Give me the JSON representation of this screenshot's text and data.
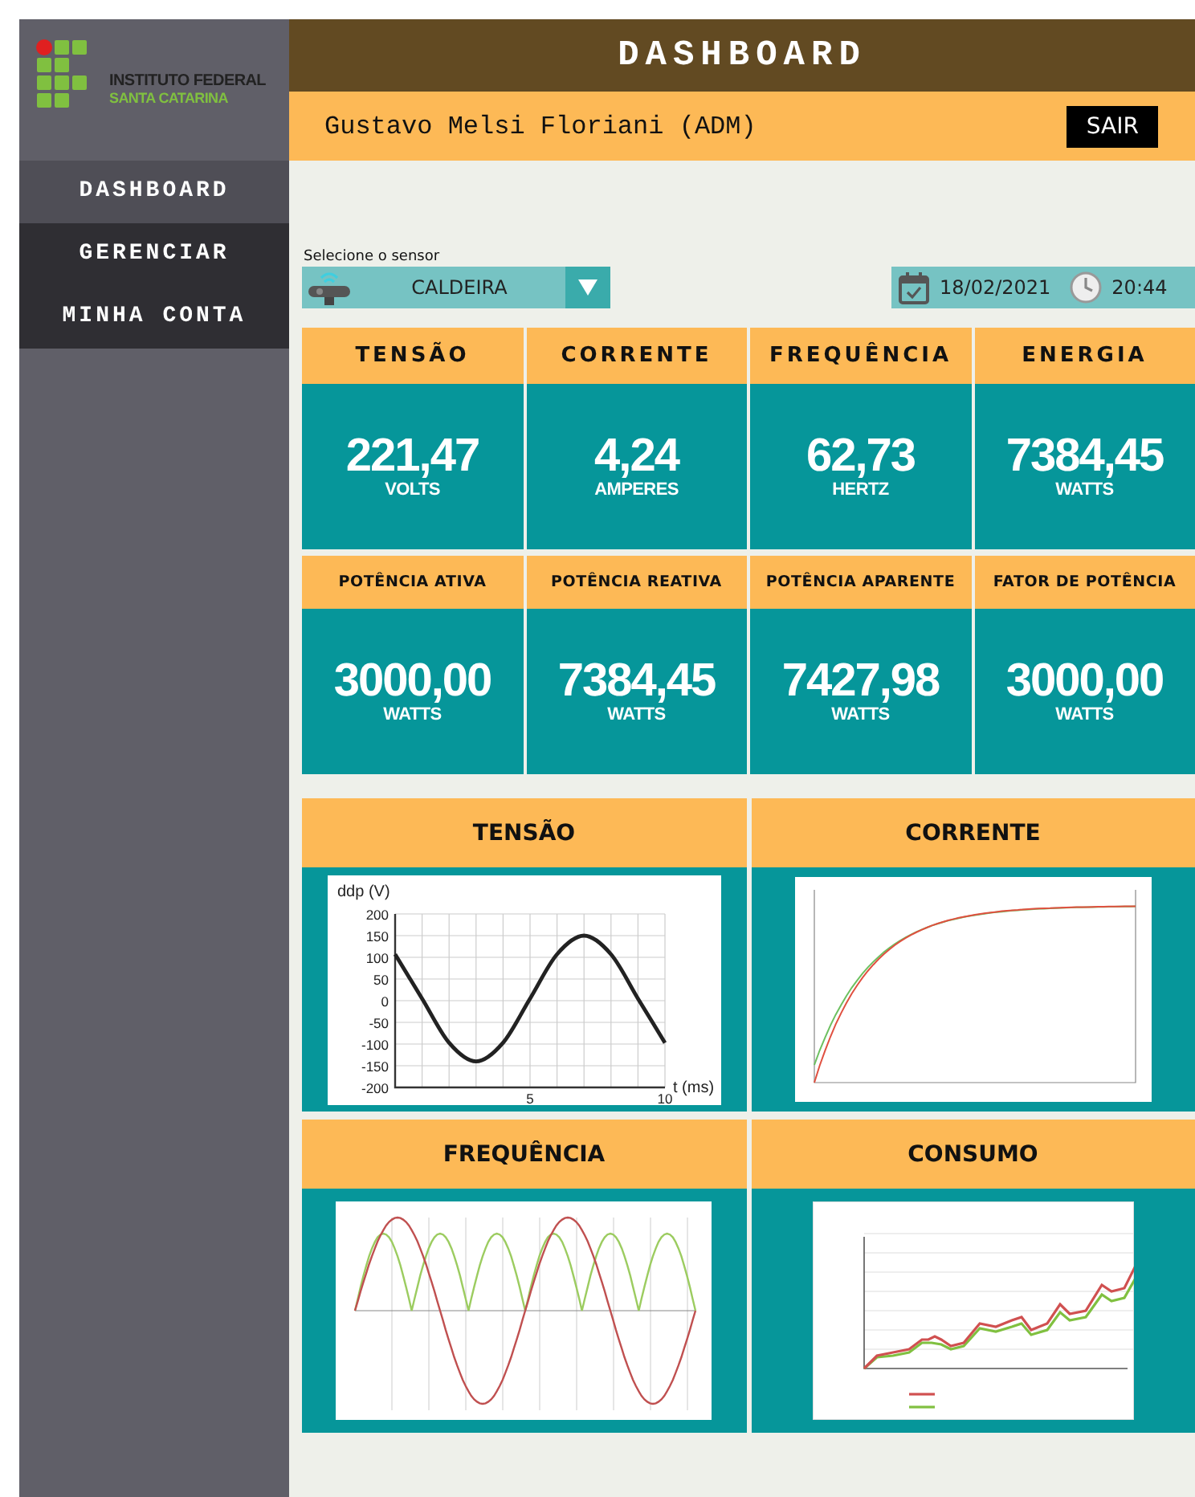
{
  "logo": {
    "line1": "INSTITUTO FEDERAL",
    "line2": "SANTA CATARINA"
  },
  "nav": [
    {
      "label": "DASHBOARD",
      "selected": true
    },
    {
      "label": "GERENCIAR",
      "selected": false
    },
    {
      "label": "MINHA CONTA",
      "selected": false
    }
  ],
  "header": {
    "title": "DASHBOARD",
    "user": "Gustavo Melsi Floriani (ADM)",
    "logout_button": "SAIR"
  },
  "sensor": {
    "label": "Selecione o sensor",
    "value": "CALDEIRA"
  },
  "date": "18/02/2021",
  "time": "20:44",
  "metric_rows": [
    [
      {
        "title": "TENSÃO",
        "value": "221,47",
        "unit": "VOLTS"
      },
      {
        "title": "CORRENTE",
        "value": "4,24",
        "unit": "AMPERES"
      },
      {
        "title": "FREQUÊNCIA",
        "value": "62,73",
        "unit": "HERTZ"
      },
      {
        "title": "ENERGIA",
        "value": "7384,45",
        "unit": "WATTS"
      }
    ],
    [
      {
        "title": "POTÊNCIA ATIVA",
        "value": "3000,00",
        "unit": "WATTS"
      },
      {
        "title": "POTÊNCIA REATIVA",
        "value": "7384,45",
        "unit": "WATTS"
      },
      {
        "title": "POTÊNCIA APARENTE",
        "value": "7427,98",
        "unit": "WATTS"
      },
      {
        "title": "FATOR DE POTÊNCIA",
        "value": "3000,00",
        "unit": "WATTS"
      }
    ]
  ],
  "charts": [
    {
      "title": "TENSÃO",
      "kind": "chart",
      "chart_data": {
        "type": "line",
        "xlabel": "t (ms)",
        "ylabel": "ddp (V)",
        "x": [
          0,
          1,
          2,
          3,
          4,
          5,
          6,
          7,
          8,
          9,
          10
        ],
        "series": [
          {
            "color": "#222222",
            "values": [
              107,
              5,
              -97,
              -140,
              -97,
              5,
              107,
              150,
              107,
              5,
              -97
            ]
          }
        ],
        "grid": true,
        "xlim": [
          0,
          10
        ],
        "ylim": [
          -200,
          200
        ],
        "xticks": [
          5,
          10
        ],
        "yticks": [
          -200,
          -150,
          -100,
          -50,
          0,
          50,
          100,
          150,
          200
        ]
      }
    },
    {
      "title": "CORRENTE",
      "kind": "rise"
    },
    {
      "title": "FREQUÊNCIA",
      "kind": "waves"
    },
    {
      "title": "CONSUMO",
      "kind": "growth"
    }
  ]
}
